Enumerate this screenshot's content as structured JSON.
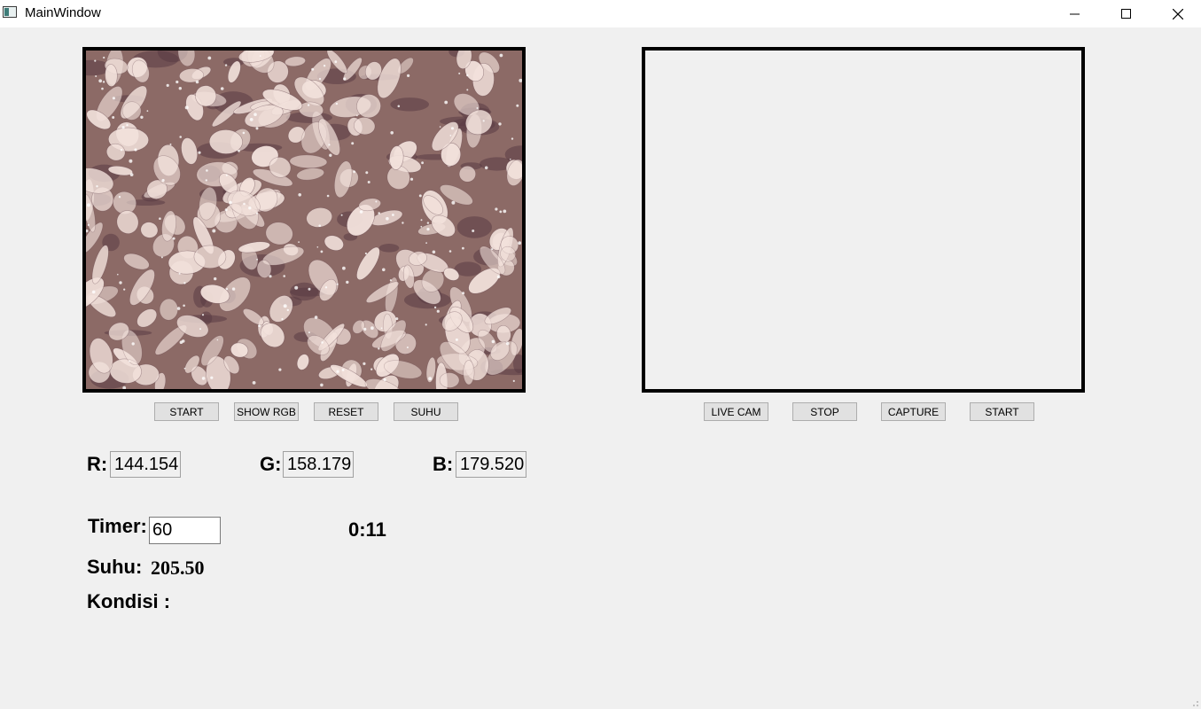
{
  "window": {
    "title": "MainWindow"
  },
  "left_panel": {
    "buttons": [
      "START",
      "SHOW RGB",
      "RESET",
      "SUHU"
    ]
  },
  "right_panel": {
    "buttons": [
      "LIVE CAM",
      "STOP",
      "CAPTURE",
      "START"
    ]
  },
  "rgb": {
    "r_label": "R:",
    "r_value": "144.154",
    "g_label": "G:",
    "g_value": "158.179",
    "b_label": "B:",
    "b_value": "179.520"
  },
  "timer": {
    "label": "Timer:",
    "value": "60",
    "elapsed": "0:11"
  },
  "suhu": {
    "label": "Suhu:",
    "value": "205.50"
  },
  "kondisi": {
    "label": "Kondisi :",
    "value": ""
  },
  "colors": {
    "sample_base": "#8c6a66",
    "sample_light": "#f3e2dc",
    "sample_dark": "#5a3a44",
    "background": "#f0f0f0"
  }
}
